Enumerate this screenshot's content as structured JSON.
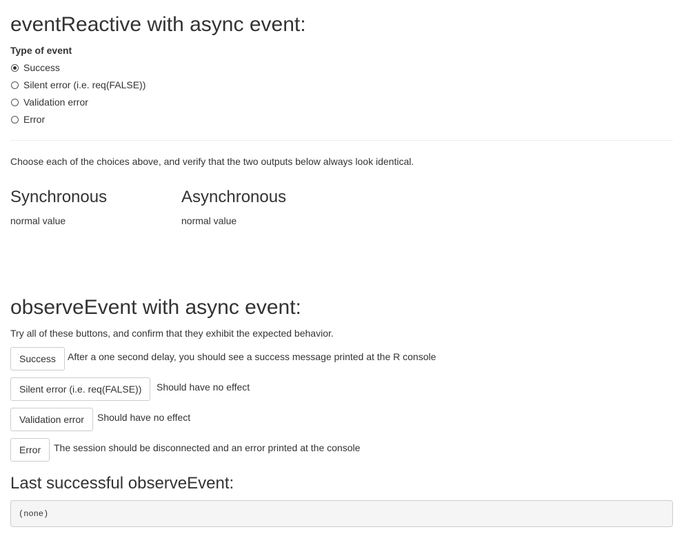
{
  "section1": {
    "title": "eventReactive with async event:",
    "radio_label": "Type of event",
    "options": [
      {
        "label": "Success",
        "checked": true
      },
      {
        "label": "Silent error (i.e. req(FALSE))",
        "checked": false
      },
      {
        "label": "Validation error",
        "checked": false
      },
      {
        "label": "Error",
        "checked": false
      }
    ],
    "instructions": "Choose each of the choices above, and verify that the two outputs below always look identical.",
    "sync": {
      "title": "Synchronous",
      "value": "normal value"
    },
    "async": {
      "title": "Asynchronous",
      "value": "normal value"
    }
  },
  "section2": {
    "title": "observeEvent with async event:",
    "instructions": "Try all of these buttons, and confirm that they exhibit the expected behavior.",
    "buttons": [
      {
        "label": "Success",
        "note": "After a one second delay, you should see a success message printed at the R console"
      },
      {
        "label": "Silent error (i.e. req(FALSE))",
        "note": "Should have no effect"
      },
      {
        "label": "Validation error",
        "note": "Should have no effect"
      },
      {
        "label": "Error",
        "note": "The session should be disconnected and an error printed at the console"
      }
    ]
  },
  "last": {
    "title": "Last successful observeEvent:",
    "value": "(none)"
  }
}
